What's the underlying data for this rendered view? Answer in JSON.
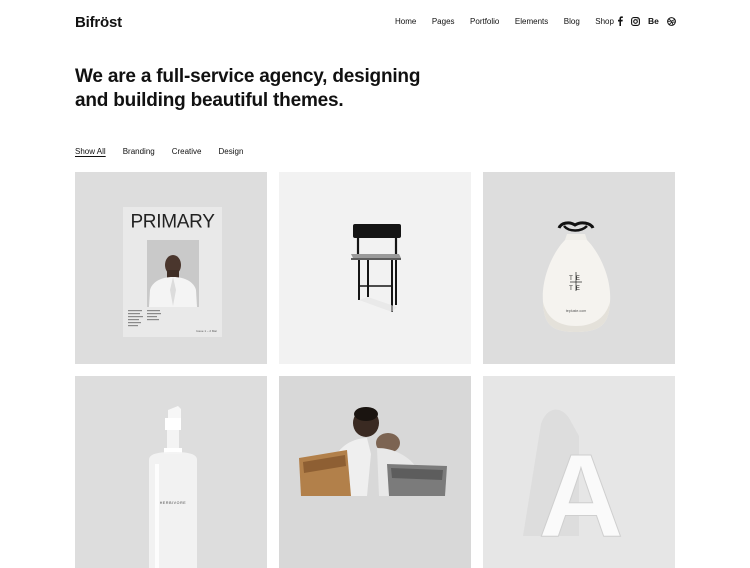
{
  "brand": {
    "name": "Bifröst"
  },
  "nav": {
    "items": [
      "Home",
      "Pages",
      "Portfolio",
      "Elements",
      "Blog",
      "Shop"
    ]
  },
  "social": {
    "icons": [
      "facebook-icon",
      "instagram-icon",
      "behance-icon",
      "dribbble-icon"
    ],
    "behance_label": "Be"
  },
  "hero": {
    "line1": "We are a full-service agency, designing",
    "line2": "and building beautiful themes."
  },
  "filters": {
    "items": [
      "Show All",
      "Branding",
      "Creative",
      "Design"
    ],
    "active": "Show All"
  },
  "portfolio": {
    "magazine_title": "PRIMARY",
    "magazine_issue": "Issue 1 – 2 Mar",
    "bag_letters": [
      "TE",
      "TE"
    ],
    "bag_url": "tepluste.com",
    "bottle_label": "HERBIVORE",
    "letter": "A"
  },
  "colors": {
    "tile_bg": "#dddddd",
    "tile_bg_light": "#f2f2f2",
    "text": "#111111"
  }
}
